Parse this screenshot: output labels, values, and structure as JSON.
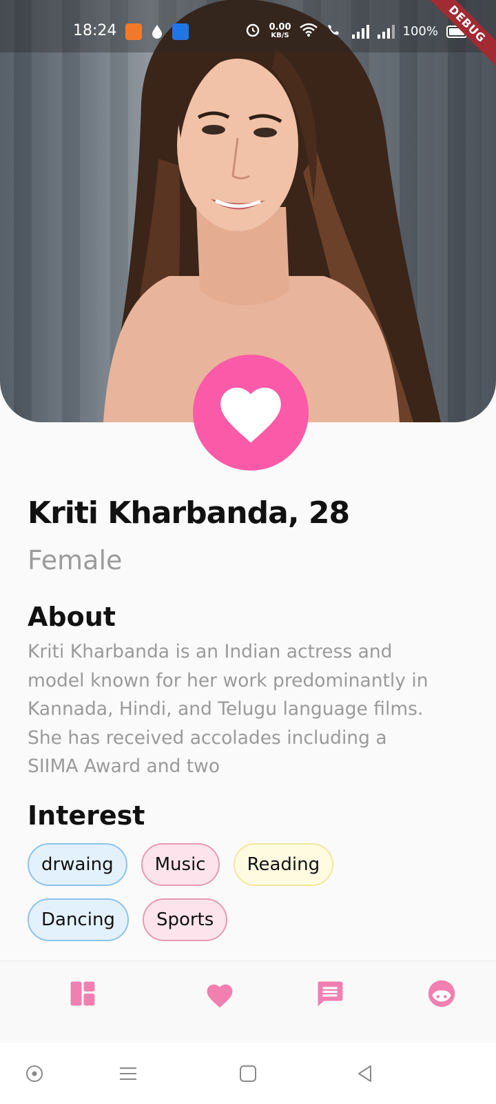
{
  "status_bar": {
    "time": "18:24",
    "net_speed_value": "0.00",
    "net_speed_unit": "KB/S",
    "battery": "100%",
    "debug_label": "DEBUG"
  },
  "profile": {
    "name_age": "Kriti Kharbanda, 28",
    "gender": "Female",
    "about_heading": "About",
    "about_text": "Kriti Kharbanda is an Indian actress and model known for her work predominantly in Kannada, Hindi, and Telugu language films. She has received accolades including a SIIMA Award and two",
    "interest_heading": "Interest",
    "interests": [
      {
        "label": "drwaing",
        "style": "blue"
      },
      {
        "label": "Music",
        "style": "pink"
      },
      {
        "label": "Reading",
        "style": "yellow"
      },
      {
        "label": "Dancing",
        "style": "blue"
      },
      {
        "label": "Sports",
        "style": "pink"
      }
    ]
  },
  "like_button": {
    "icon": "heart-icon",
    "color": "#fb5aa8"
  },
  "bottom_nav": {
    "accent_color": "#f17fb0",
    "items": [
      {
        "icon": "dashboard-icon"
      },
      {
        "icon": "heart-icon"
      },
      {
        "icon": "chat-icon"
      },
      {
        "icon": "face-icon"
      }
    ]
  },
  "system_nav": {
    "items": [
      "assistant-circle-icon",
      "menu-lines-icon",
      "home-square-icon",
      "back-triangle-icon"
    ]
  }
}
